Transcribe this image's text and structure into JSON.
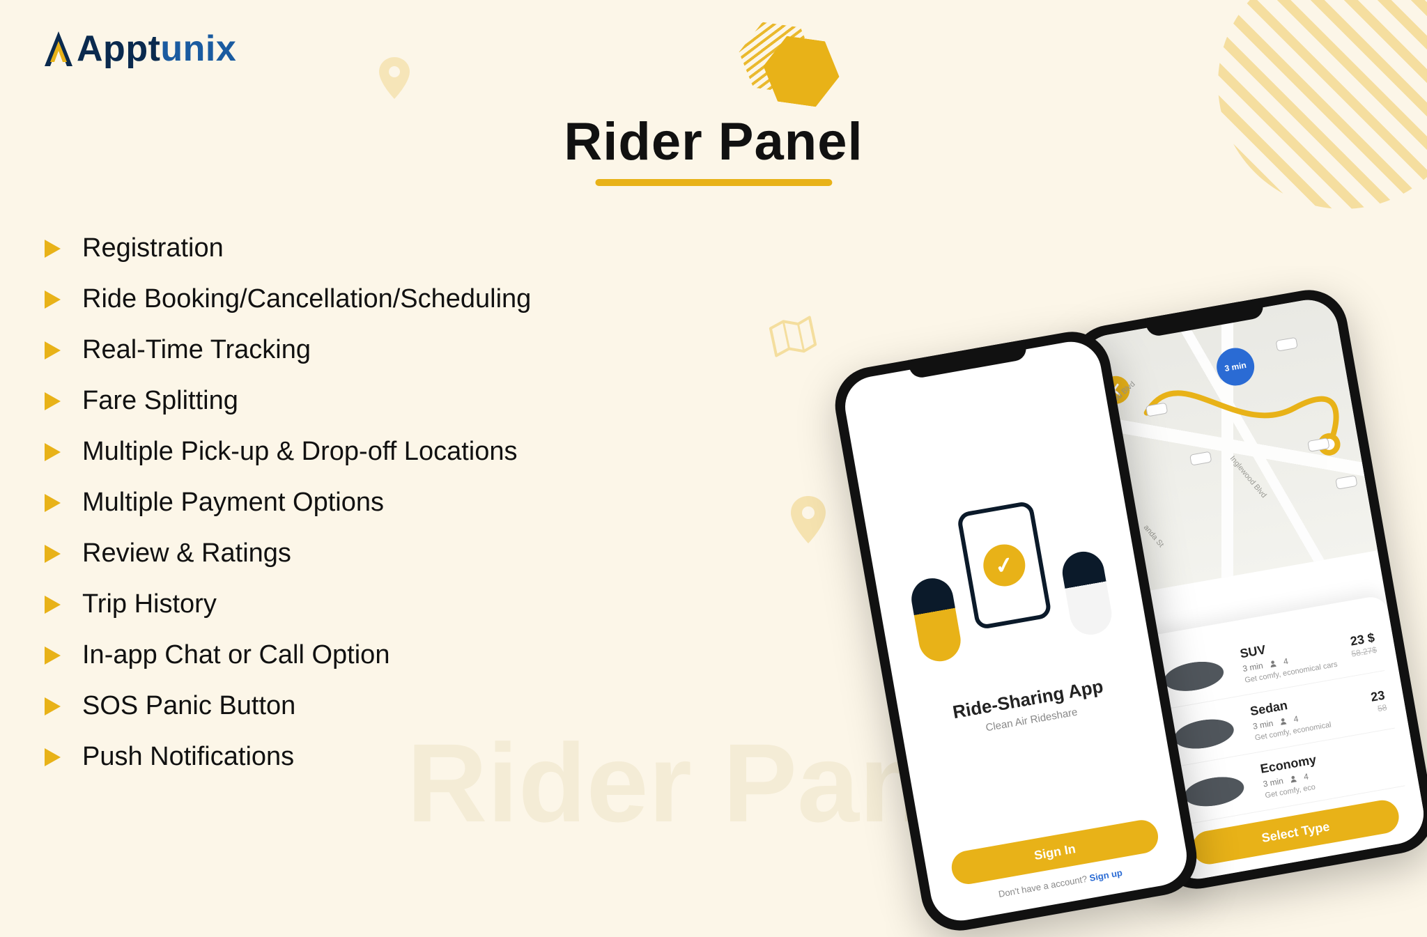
{
  "brand": {
    "part1": "Appt",
    "part2": "unix"
  },
  "heading": "Rider Panel",
  "watermark": "Rider Panel",
  "features": [
    "Registration",
    "Ride Booking/Cancellation/Scheduling",
    "Real-Time Tracking",
    "Fare Splitting",
    "Multiple Pick-up & Drop-off Locations",
    "Multiple Payment Options",
    "Review & Ratings",
    "Trip History",
    "In-app Chat or Call Option",
    "SOS Panic Button",
    "Push Notifications"
  ],
  "colors": {
    "accent": "#e8b218",
    "bg": "#fcf6e8",
    "brand_dark": "#0a2a4e",
    "brand_blue": "#1a5ba0"
  },
  "phone_a": {
    "title": "Ride-Sharing App",
    "subtitle": "Clean Air Rideshare",
    "button": "Sign In",
    "footer_text": "Don't have a account? ",
    "footer_link": "Sign up"
  },
  "phone_b": {
    "eta_badge": "3 min",
    "map_labels": {
      "l1": "ood Blvd",
      "l2": "Inglewood Blvd",
      "l3": "anda St"
    },
    "rides": [
      {
        "name": "SUV",
        "time": "3 min",
        "seats": "4",
        "desc": "Get comfy, economical cars",
        "price": "23 $",
        "price_was": "58.27$"
      },
      {
        "name": "Sedan",
        "time": "3 min",
        "seats": "4",
        "desc": "Get comfy, economical",
        "price": "23",
        "price_was": "58"
      },
      {
        "name": "Economy",
        "time": "3 min",
        "seats": "4",
        "desc": "Get comfy, eco",
        "price": "",
        "price_was": ""
      }
    ],
    "button": "Select Type"
  }
}
